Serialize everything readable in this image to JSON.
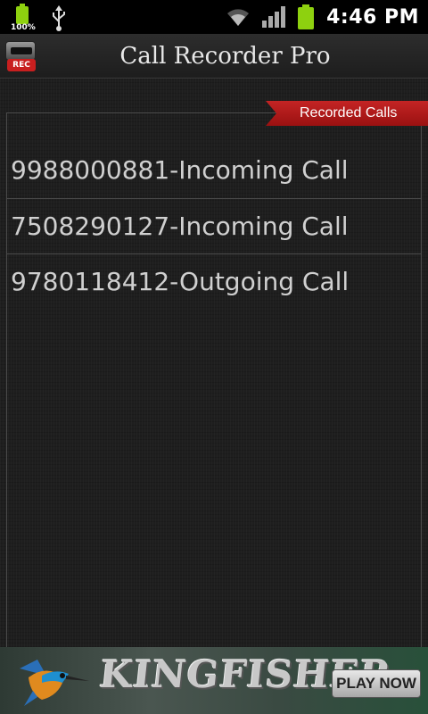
{
  "status_bar": {
    "battery_percent_label": "100%",
    "time": "4:46 PM",
    "icons": [
      "battery-icon",
      "usb-icon",
      "wifi-icon",
      "signal-icon",
      "battery-icon"
    ],
    "battery_color": "#8ed10f"
  },
  "app": {
    "title": "Call Recorder Pro",
    "icon_label": "REC"
  },
  "tab": {
    "label": "Recorded Calls",
    "color": "#b51b1b"
  },
  "recordings": [
    {
      "label": "9988000881-Incoming Call"
    },
    {
      "label": "7508290127-Incoming Call"
    },
    {
      "label": "9780118412-Outgoing Call"
    }
  ],
  "ad": {
    "brand": "KINGFISHER",
    "cta": "PLAY NOW"
  }
}
